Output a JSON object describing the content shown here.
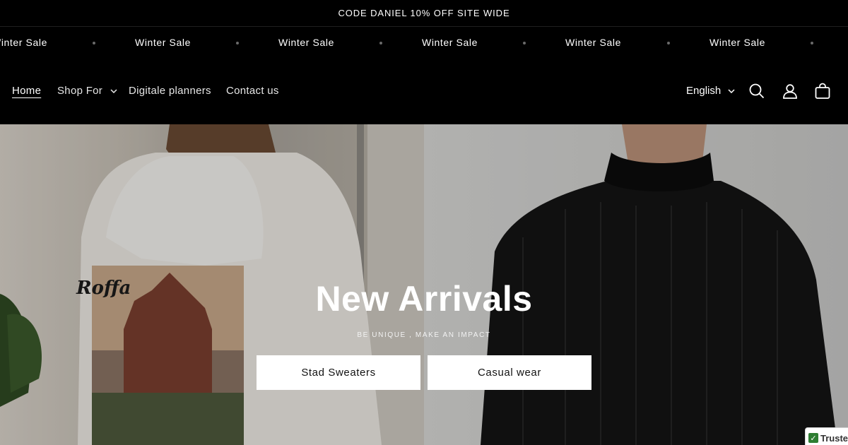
{
  "announcement": {
    "text": "CODE DANIEL 10% OFF SITE WIDE"
  },
  "marquee": {
    "items": [
      "Winter Sale",
      "Winter Sale",
      "Winter Sale",
      "Winter Sale",
      "Winter Sale",
      "Winter Sale"
    ]
  },
  "header": {
    "nav": [
      {
        "label": "Home",
        "active": true
      },
      {
        "label": "Shop For",
        "has_dropdown": true
      },
      {
        "label": "Digitale planners"
      },
      {
        "label": "Contact us"
      }
    ],
    "language": "English",
    "icons": [
      "search-icon",
      "account-icon",
      "cart-icon"
    ]
  },
  "hero": {
    "title": "New Arrivals",
    "subtitle": "BE UNIQUE , MAKE AN IMPACT",
    "buttons": [
      "Stad Sweaters",
      "Casual wear"
    ]
  },
  "badge": {
    "label": "Trusted"
  },
  "colors": {
    "background": "#000000",
    "text": "#ffffff",
    "button_bg": "#ffffff",
    "button_text": "#121212"
  }
}
